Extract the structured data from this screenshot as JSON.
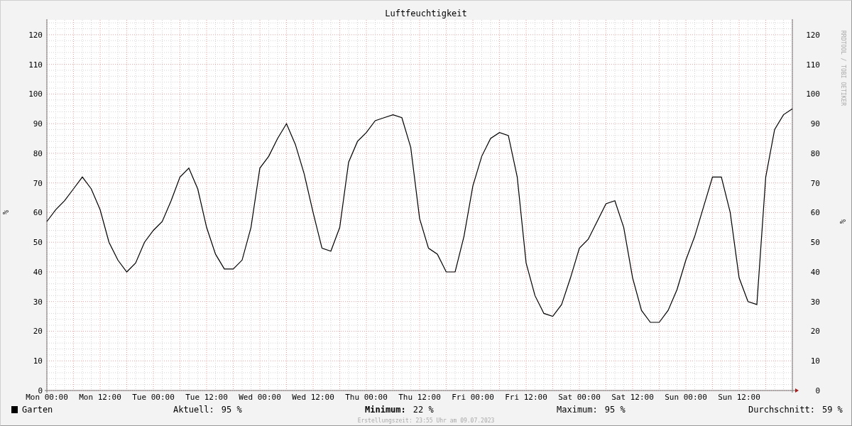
{
  "graph": {
    "title": "Luftfeuchtigkeit",
    "credit": "RRDTOOL / TOBI OETIKER",
    "chart_data": {
      "type": "line",
      "ylabel": "%",
      "categories": [
        "Mon 00:00",
        null,
        null,
        null,
        null,
        null,
        "Mon 12:00",
        null,
        null,
        null,
        null,
        null,
        "Tue 00:00",
        null,
        null,
        null,
        null,
        null,
        "Tue 12:00",
        null,
        null,
        null,
        null,
        null,
        "Wed 00:00",
        null,
        null,
        null,
        null,
        null,
        "Wed 12:00",
        null,
        null,
        null,
        null,
        null,
        "Thu 00:00",
        null,
        null,
        null,
        null,
        null,
        "Thu 12:00",
        null,
        null,
        null,
        null,
        null,
        "Fri 00:00",
        null,
        null,
        null,
        null,
        null,
        "Fri 12:00",
        null,
        null,
        null,
        null,
        null,
        "Sat 00:00",
        null,
        null,
        null,
        null,
        null,
        "Sat 12:00",
        null,
        null,
        null,
        null,
        null,
        "Sun 00:00",
        null,
        null,
        null,
        null,
        null,
        "Sun 12:00",
        null,
        null,
        null,
        null,
        null,
        null
      ],
      "series": [
        {
          "name": "Garten",
          "color": "#000000",
          "values": [
            57,
            61,
            64,
            68,
            72,
            68,
            61,
            50,
            44,
            40,
            43,
            50,
            54,
            57,
            64,
            72,
            75,
            68,
            55,
            46,
            41,
            41,
            44,
            55,
            75,
            79,
            85,
            90,
            83,
            73,
            60,
            48,
            47,
            55,
            77,
            84,
            87,
            91,
            92,
            93,
            92,
            82,
            58,
            48,
            46,
            40,
            40,
            52,
            69,
            79,
            85,
            87,
            86,
            72,
            43,
            32,
            26,
            25,
            29,
            38,
            48,
            51,
            57,
            63,
            64,
            55,
            38,
            27,
            23,
            23,
            27,
            34,
            44,
            52,
            62,
            72,
            72,
            60,
            38,
            30,
            29,
            72,
            88,
            93,
            95
          ]
        }
      ],
      "ylim": [
        0,
        125
      ],
      "grid": true,
      "yticks": [
        0,
        10,
        20,
        30,
        40,
        50,
        60,
        70,
        80,
        90,
        100,
        110,
        120
      ]
    },
    "right_axis": {
      "label": "%",
      "ticks": [
        "120",
        "110",
        "100",
        "90",
        "80",
        "70",
        "60",
        "50",
        "40",
        "30",
        "20",
        "10",
        "0"
      ]
    },
    "legend": {
      "stats": [
        {
          "label": "Aktuell:",
          "value": "95 %",
          "emphasized": false
        },
        {
          "label": "Minimum:",
          "value": "22 %",
          "emphasized": true
        },
        {
          "label": "Maximum:",
          "value": "95 %",
          "emphasized": false
        },
        {
          "label": "Durchschnitt:",
          "value": "59 %",
          "emphasized": false
        }
      ]
    },
    "footer": "Erstellungszeit: 23:55 Uhr am 09.07.2023"
  }
}
